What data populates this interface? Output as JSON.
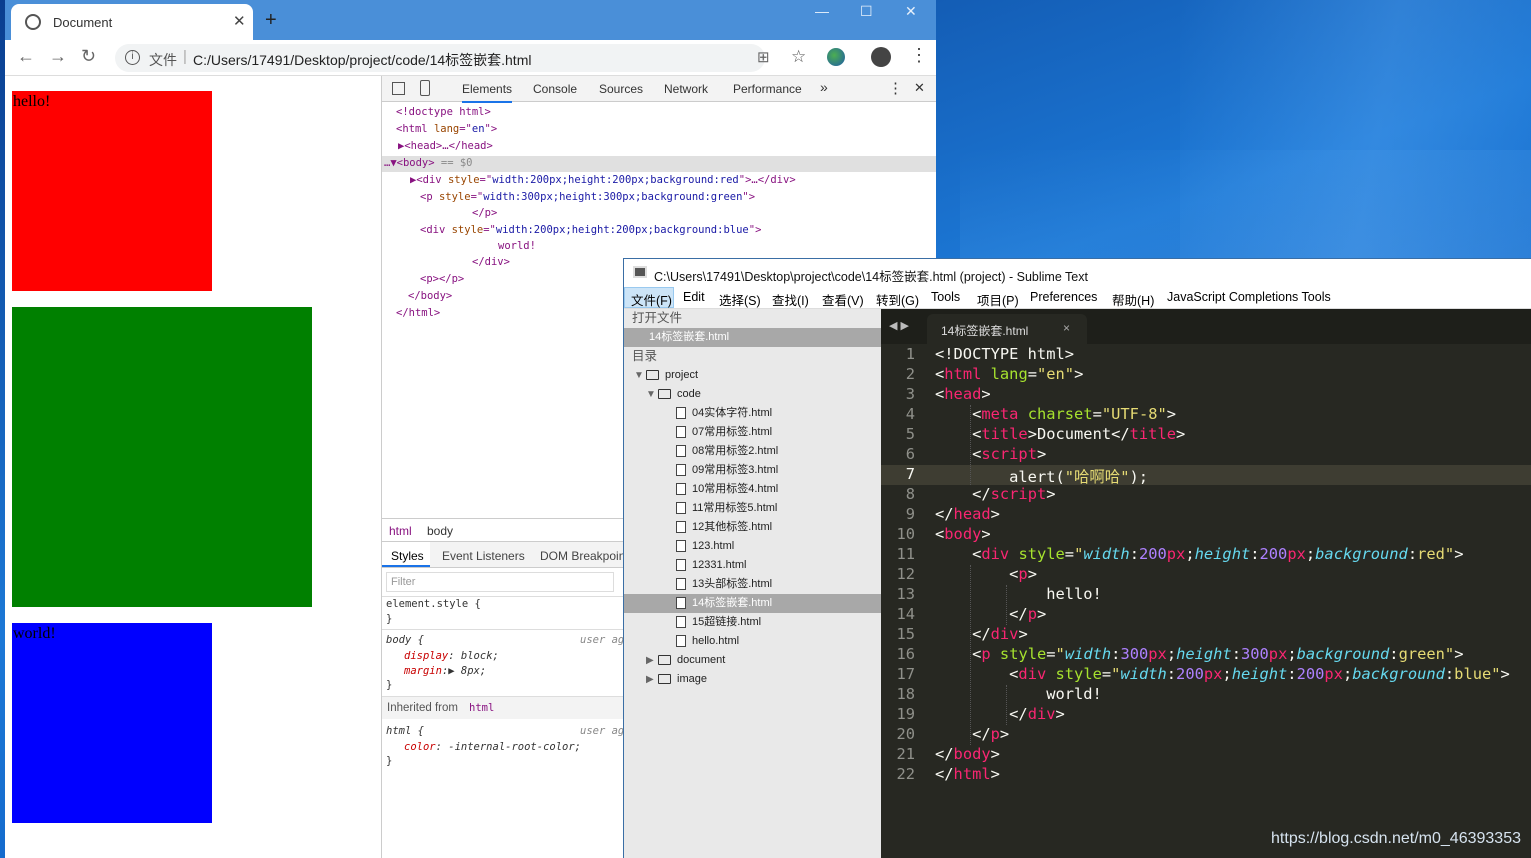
{
  "watermark": "https://blog.csdn.net/m0_46393353",
  "browser": {
    "tab_title": "Document",
    "tab_close": "✕",
    "new_tab": "+",
    "win_min": "—",
    "win_max": "☐",
    "win_close": "✕",
    "back_icon": "←",
    "forward_icon": "→",
    "reload_icon": "↻",
    "info_icon": "i",
    "scheme": "文件",
    "separator": "|",
    "url": "C:/Users/17491/Desktop/project/code/14标签嵌套.html",
    "translate_icon": "⊞",
    "star_icon": "☆",
    "menu_icon": "⋮"
  },
  "page": {
    "boxes": [
      {
        "text": "hello!",
        "color": "#ff0000"
      },
      {
        "text": "",
        "color": "#008000"
      },
      {
        "text": "world!",
        "color": "#0000ff"
      }
    ]
  },
  "devtools": {
    "tabs": [
      "Elements",
      "Console",
      "Sources",
      "Network",
      "Performance"
    ],
    "more": "»",
    "kebab": "⋮",
    "close": "✕",
    "dom": {
      "l1": "<!doctype html>",
      "l2a": "<html ",
      "l2b": "lang",
      "l2c": "=\"",
      "l2d": "en",
      "l2e": "\">",
      "l3": "▶<head>…</head>",
      "l4a": "…▼<body>",
      "l4b": " == $0",
      "l5a": "▶<div ",
      "l5b": "style",
      "l5c": "=\"",
      "l5d": "width:200px;height:200px;background:red",
      "l5e": "\">…</div>",
      "l6a": "<p ",
      "l6b": "style",
      "l6c": "=\"",
      "l6d": "width:300px;height:300px;background:green",
      "l6e": "\">",
      "l7": "</p>",
      "l8a": "<div ",
      "l8b": "style",
      "l8c": "=\"",
      "l8d": "width:200px;height:200px;background:blue",
      "l8e": "\">",
      "l9": "world!",
      "l10": "</div>",
      "l11": "<p></p>",
      "l12": "</body>",
      "l13": "</html>"
    },
    "crumbs": [
      "html",
      "body"
    ],
    "subtabs": [
      "Styles",
      "Event Listeners",
      "DOM Breakpoin"
    ],
    "filter_placeholder": "Filter",
    "styles": {
      "s1": "element.style {",
      "s2": "}",
      "s3a": "body {",
      "s3b": "user ag",
      "s4a": "display",
      "s4b": ": block;",
      "s5a": "margin",
      "s5b": ":▶ 8px;",
      "s6": "}",
      "inh_a": "Inherited from ",
      "inh_b": "html",
      "s7a": "html {",
      "s7b": "user ag",
      "s8a": "color",
      "s8b": ": -internal-root-color;",
      "s9": "}"
    }
  },
  "sublime": {
    "title": "C:\\Users\\17491\\Desktop\\project\\code\\14标签嵌套.html (project) - Sublime Text",
    "menu": [
      "文件(F)",
      "Edit",
      "选择(S)",
      "查找(I)",
      "查看(V)",
      "转到(G)",
      "Tools",
      "项目(P)",
      "Preferences",
      "帮助(H)",
      "JavaScript Completions Tools"
    ],
    "open_files_header": "打开文件",
    "open_file": "14标签嵌套.html",
    "folders_header": "目录",
    "project": "project",
    "code_folder": "code",
    "files": [
      "04实体字符.html",
      "07常用标签.html",
      "08常用标签2.html",
      "09常用标签3.html",
      "10常用标签4.html",
      "11常用标签5.html",
      "12其他标签.html",
      "123.html",
      "12331.html",
      "13头部标签.html",
      "14标签嵌套.html",
      "15超链接.html",
      "hello.html"
    ],
    "other_folders": [
      "document",
      "image"
    ],
    "tab_name": "14标签嵌套.html",
    "tab_close": "×",
    "tab_arrows": "◀ ▶",
    "line_numbers": [
      "1",
      "2",
      "3",
      "4",
      "5",
      "6",
      "7",
      "8",
      "9",
      "10",
      "11",
      "12",
      "13",
      "14",
      "15",
      "16",
      "17",
      "18",
      "19",
      "20",
      "21",
      "22"
    ],
    "current_line": 7
  }
}
